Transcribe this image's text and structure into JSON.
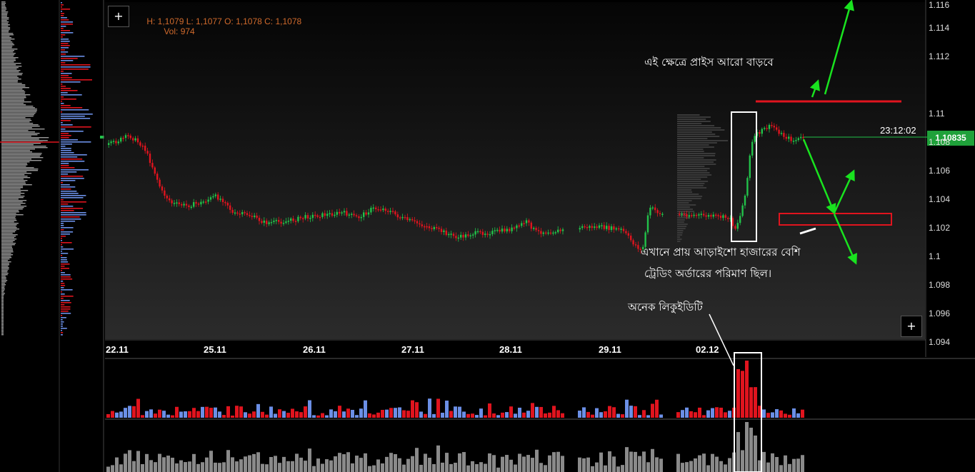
{
  "header": {
    "ohlc_text": "H: 1,1079 L: 1,1077 O: 1,1078 C: 1,1078",
    "volume_text": "Vol: 974"
  },
  "buttons": {
    "top_add": "+",
    "bottom_add": "+"
  },
  "annotations": {
    "top_note": "এই ক্ষেত্রে প্রাইস আরো বাড়বে",
    "middle_note_line1": "এখানে প্রায় আড়াইশো হাজারের বেশি",
    "middle_note_line2": "ট্রেডিং অর্ডারের পরিমাণ ছিল।",
    "bottom_note": "অনেক লিকুইডিটি"
  },
  "current_price": "1,10835",
  "countdown": "23:12:02",
  "colors": {
    "up": "#22c24a",
    "down": "#e0141e",
    "arrow": "#19e31f",
    "buy_volume": "#6b8fe6",
    "sell_volume": "#e0141e",
    "total_volume": "#8a8a8a",
    "price_tag": "#1fa13a"
  },
  "chart_data": {
    "type": "candlestick",
    "price_ticks": [
      "1.116",
      "1.114",
      "1.112",
      "1.11",
      "1.108",
      "1.106",
      "1.104",
      "1.102",
      "1.1",
      "1.098",
      "1.096",
      "1.094"
    ],
    "date_ticks": [
      "22.11",
      "25.11",
      "26.11",
      "27.11",
      "28.11",
      "29.11",
      "02.12"
    ],
    "ylim": [
      1.094,
      1.117
    ],
    "levels": {
      "resistance": 1.111,
      "support_zone": [
        1.1022,
        1.103
      ]
    }
  }
}
